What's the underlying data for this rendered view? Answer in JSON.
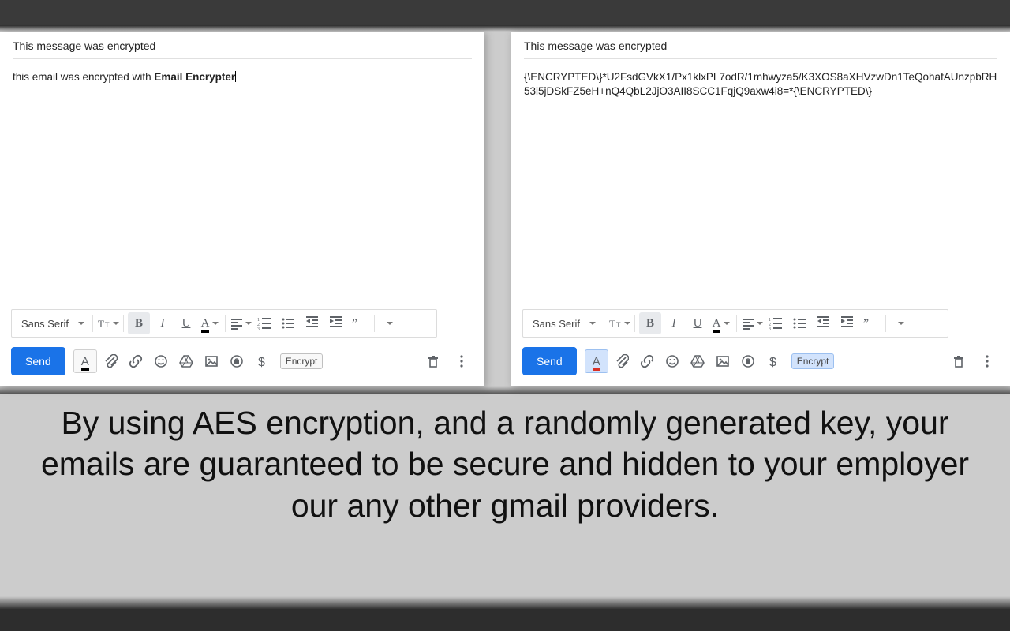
{
  "left": {
    "subject": "This message was encrypted",
    "body_prefix": "this email was encrypted with ",
    "body_bold": "Email Encrypter",
    "send": "Send",
    "font": "Sans Serif",
    "encrypt": "Encrypt"
  },
  "right": {
    "subject": "This message was encrypted",
    "body": "{\\ENCRYPTED\\}*U2FsdGVkX1/Px1klxPL7odR/1mhwyza5/K3XOS8aXHVzwDn1TeQohafAUnzpbRH53i5jDSkFZ5eH+nQ4QbL2JjO3AII8SCC1FqjQ9axw4i8=*{\\ENCRYPTED\\}",
    "send": "Send",
    "font": "Sans Serif",
    "encrypt": "Encrypt"
  },
  "marketing": "By using AES encryption, and a randomly generated key, your emails are guaranteed to be secure and hidden to your employer our any other gmail providers."
}
